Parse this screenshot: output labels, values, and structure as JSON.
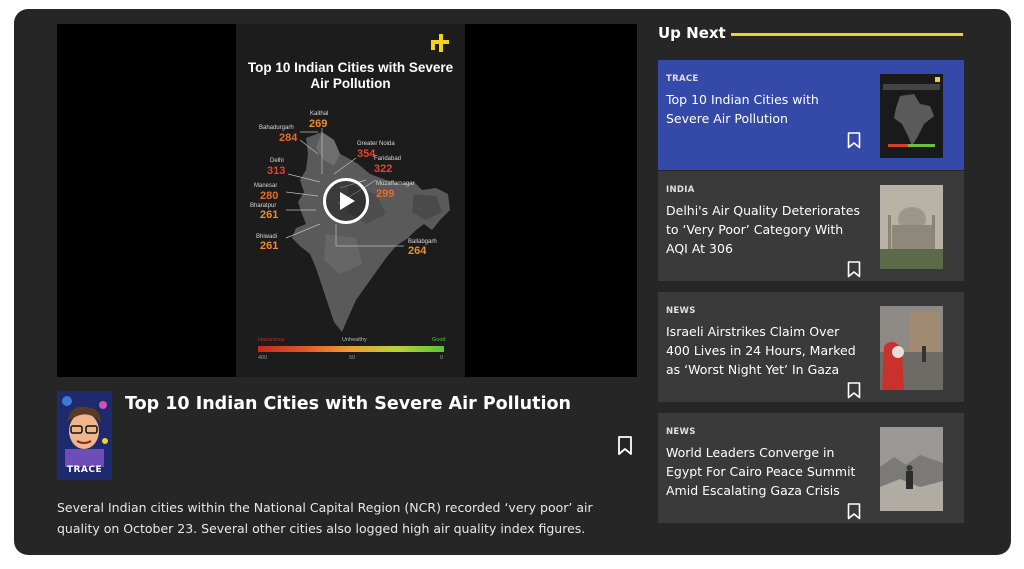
{
  "player": {
    "poster_title": "Top 10 Indian Cities with Severe Air Pollution",
    "cities": [
      {
        "name": "Kaithal",
        "value": "269"
      },
      {
        "name": "Bahadurgarh",
        "value": "284"
      },
      {
        "name": "Greater Noida",
        "value": "354"
      },
      {
        "name": "Faridabad",
        "value": "322"
      },
      {
        "name": "Delhi",
        "value": "313"
      },
      {
        "name": "Muzaffarnagar",
        "value": "299"
      },
      {
        "name": "Manesar",
        "value": "280"
      },
      {
        "name": "Bharatpur",
        "value": "261"
      },
      {
        "name": "Bhiwadi",
        "value": "261"
      },
      {
        "name": "Ballabgarh",
        "value": "264"
      }
    ],
    "scale_labels": {
      "hazardous": "Hazardous",
      "unhealthy": "Unhealthy",
      "good": "Good"
    },
    "scale_ticks": [
      "400",
      "50",
      "0"
    ],
    "colors": {
      "severe": "#e2452f",
      "high": "#e86a2a",
      "moderate": "#eb8c2e"
    }
  },
  "video": {
    "channel_tag": "TRACE",
    "title": "Top 10 Indian Cities with Severe Air Pollution",
    "description": "Several Indian cities within the National Capital Region (NCR) recorded ‘very poor’ air quality on October 23. Several other cities also logged high air quality index figures."
  },
  "up_next": {
    "heading": "Up Next",
    "accent_color": "#f2d21f",
    "items": [
      {
        "kicker": "TRACE",
        "title": "Top 10 Indian Cities with Severe Air Pollution",
        "active": true
      },
      {
        "kicker": "INDIA",
        "title": "Delhi's Air Quality Deteriorates to ‘Very Poor’ Category With AQI At 306",
        "active": false
      },
      {
        "kicker": "NEWS",
        "title": "Israeli Airstrikes Claim Over 400 Lives in 24 Hours, Marked as ‘Worst Night Yet’ In Gaza",
        "active": false
      },
      {
        "kicker": "NEWS",
        "title": "World Leaders Converge in Egypt For Cairo Peace Summit Amid Escalating Gaza Crisis",
        "active": false
      }
    ]
  },
  "icons": {
    "play": "play-icon",
    "bookmark": "bookmark-icon",
    "logo": "brand-logo-icon"
  }
}
